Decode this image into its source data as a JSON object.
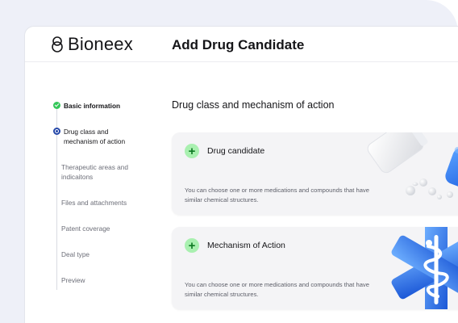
{
  "app": {
    "logo_text": "Bioneex",
    "page_title": "Add Drug Candidate"
  },
  "steps": [
    {
      "label": "Basic information",
      "state": "done"
    },
    {
      "label": "Drug class and mechanism of action",
      "state": "current"
    },
    {
      "label": "Therapeutic areas and indicaitons",
      "state": "todo"
    },
    {
      "label": "Files and attachments",
      "state": "todo"
    },
    {
      "label": "Patent coverage",
      "state": "todo"
    },
    {
      "label": "Deal type",
      "state": "todo"
    },
    {
      "label": "Preview",
      "state": "todo"
    }
  ],
  "main": {
    "section_title": "Drug class and mechanism of action",
    "cards": [
      {
        "plus": "+",
        "title": "Drug candidate",
        "description": "You can choose one or more medications and compounds that have similar chemical structures.",
        "illustration": "pills-bottle"
      },
      {
        "plus": "+",
        "title": "Mechanism of Action",
        "description": "You can choose one or more medications and compounds that have similar chemical structures.",
        "illustration": "medical-star"
      }
    ]
  },
  "colors": {
    "accent_green": "#34c759",
    "accent_blue": "#2447a8",
    "plus_bg": "#a9f0b0",
    "illustration_blue": "#3b82f6"
  }
}
